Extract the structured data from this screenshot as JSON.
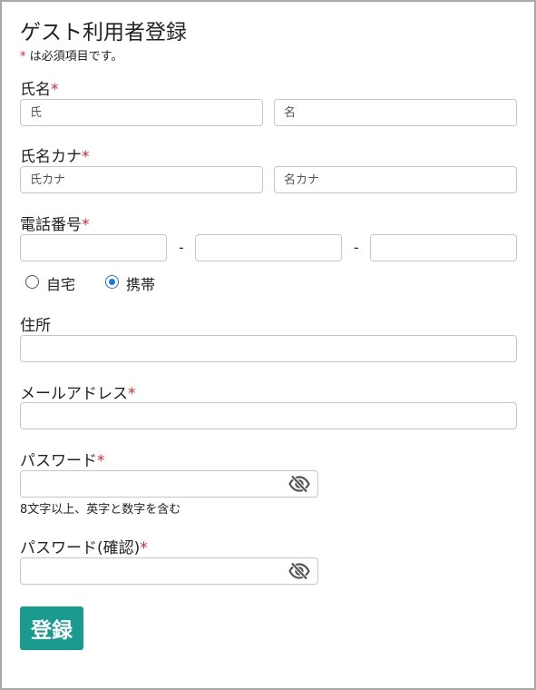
{
  "form": {
    "title": "ゲスト利用者登録",
    "required_mark": "*",
    "required_note": "は必須項目です。",
    "name": {
      "label": "氏名",
      "last_placeholder": "氏",
      "first_placeholder": "名"
    },
    "kana": {
      "label": "氏名カナ",
      "last_placeholder": "氏カナ",
      "first_placeholder": "名カナ"
    },
    "phone": {
      "label": "電話番号",
      "separator": "-",
      "type_options": [
        {
          "label": "自宅",
          "selected": false
        },
        {
          "label": "携帯",
          "selected": true
        }
      ]
    },
    "address": {
      "label": "住所"
    },
    "email": {
      "label": "メールアドレス"
    },
    "password": {
      "label": "パスワード",
      "hint": "8文字以上、英字と数字を含む",
      "toggle_icon": "eye-slash-icon"
    },
    "password_confirm": {
      "label": "パスワード(確認)",
      "toggle_icon": "eye-slash-icon"
    },
    "submit_label": "登録"
  },
  "colors": {
    "required": "#e0262f",
    "button": "#1b9a8f",
    "radio_selected": "#1a73e8",
    "border": "#c6c6c6"
  }
}
